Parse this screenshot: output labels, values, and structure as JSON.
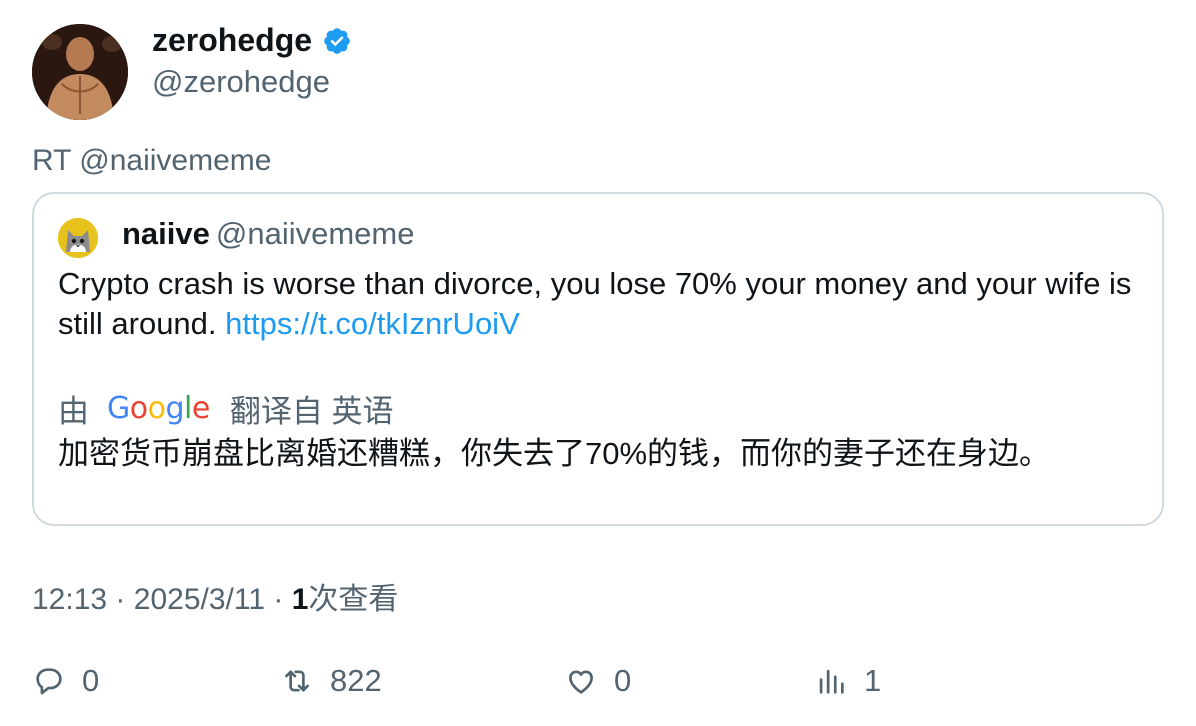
{
  "author": {
    "display_name": "zerohedge",
    "handle": "@zerohedge",
    "verified_icon": "verified-badge-icon"
  },
  "retweet_line": "RT @naiivememe",
  "quoted": {
    "name": "naiive",
    "handle": "@naiivememe",
    "text": "Crypto crash is worse than divorce, you lose 70% your money and your wife is still around. ",
    "link": "https://t.co/tkIznrUoiV",
    "translate": {
      "prefix": "由",
      "suffix": "翻译自 英语",
      "google_letters": [
        "G",
        "o",
        "o",
        "g",
        "l",
        "e"
      ]
    },
    "translated_text": "加密货币崩盘比离婚还糟糕，你失去了70%的钱，而你的妻子还在身边。"
  },
  "meta": {
    "time": "12:13",
    "sep": "·",
    "date": "2025/3/11",
    "views_count": "1",
    "views_label": "次查看"
  },
  "actions": {
    "replies": "0",
    "retweets": "822",
    "likes": "0",
    "views": "1"
  },
  "colors": {
    "text": "#0f1419",
    "secondary": "#536471",
    "link": "#1d9bf0",
    "border": "#cfd9de",
    "google": [
      "#4285f4",
      "#ea4335",
      "#fbbc05",
      "#4285f4",
      "#34a853",
      "#ea4335"
    ]
  }
}
